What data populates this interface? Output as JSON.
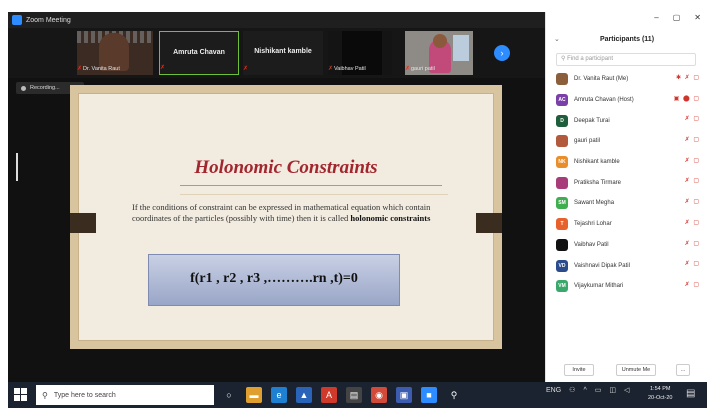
{
  "window": {
    "title": "Zoom Meeting"
  },
  "video_strip": {
    "tiles": [
      {
        "name": "Dr. Vanita Raut",
        "type": "video"
      },
      {
        "name": "Amruta Chavan",
        "type": "name"
      },
      {
        "name": "Nishikant kamble",
        "type": "name"
      },
      {
        "name": "Vaibhav Patil",
        "type": "video"
      },
      {
        "name": "gauri patil",
        "type": "video"
      }
    ]
  },
  "recording": {
    "label": "Recording..."
  },
  "slide": {
    "title": "Holonomic Constraints",
    "body_text": "If the conditions of constraint can be expressed in mathematical equation which contain coordinates of the particles (possibly with time) then it is called",
    "body_bold": "holonomic constraints",
    "equation": "f(r1 , r2 , r3 ,……….rn ,t)=0"
  },
  "participants_panel": {
    "window_controls": [
      "–",
      "▢",
      "✕"
    ],
    "title": "Participants (11)",
    "search_placeholder": "Find a participant",
    "participants": [
      {
        "name": "Dr. Vanita Raut (Me)",
        "initials": "",
        "color": "#8b5e3c",
        "icons": "✱ ✗ ▢"
      },
      {
        "name": "Amruta Chavan (Host)",
        "initials": "AC",
        "color": "#7b3fa8",
        "icons": "▣ ⬤ ▢"
      },
      {
        "name": "Deepak Turai",
        "initials": "D",
        "color": "#1f5e3a",
        "icons": "✗ ▢"
      },
      {
        "name": "gauri patil",
        "initials": "",
        "color": "#b25a3c",
        "icons": "✗ ▢"
      },
      {
        "name": "Nishikant kamble",
        "initials": "NK",
        "color": "#e98e2b",
        "icons": "✗ ▢"
      },
      {
        "name": "Pratiksha Tirmare",
        "initials": "",
        "color": "#a83c7a",
        "icons": "✗ ▢"
      },
      {
        "name": "Sawant Megha",
        "initials": "SM",
        "color": "#3fae50",
        "icons": "✗ ▢"
      },
      {
        "name": "Tejashri Lohar",
        "initials": "T",
        "color": "#e8612c",
        "icons": "✗ ▢"
      },
      {
        "name": "Vaibhav Patil",
        "initials": "",
        "color": "#111111",
        "icons": "✗ ▢"
      },
      {
        "name": "Vaishnavi Dipak Patil",
        "initials": "VD",
        "color": "#2b4c8c",
        "icons": "✗ ▢"
      },
      {
        "name": "Vijaykumar Mithari",
        "initials": "VM",
        "color": "#3aa86a",
        "icons": "✗ ▢"
      }
    ],
    "footer": {
      "invite": "Invite",
      "unmute": "Unmute Me",
      "more": "..."
    }
  },
  "taskbar": {
    "search_placeholder": "Type here to search",
    "tray_lang": "ENG",
    "time": "1:54 PM",
    "date": "20-Oct-20"
  }
}
